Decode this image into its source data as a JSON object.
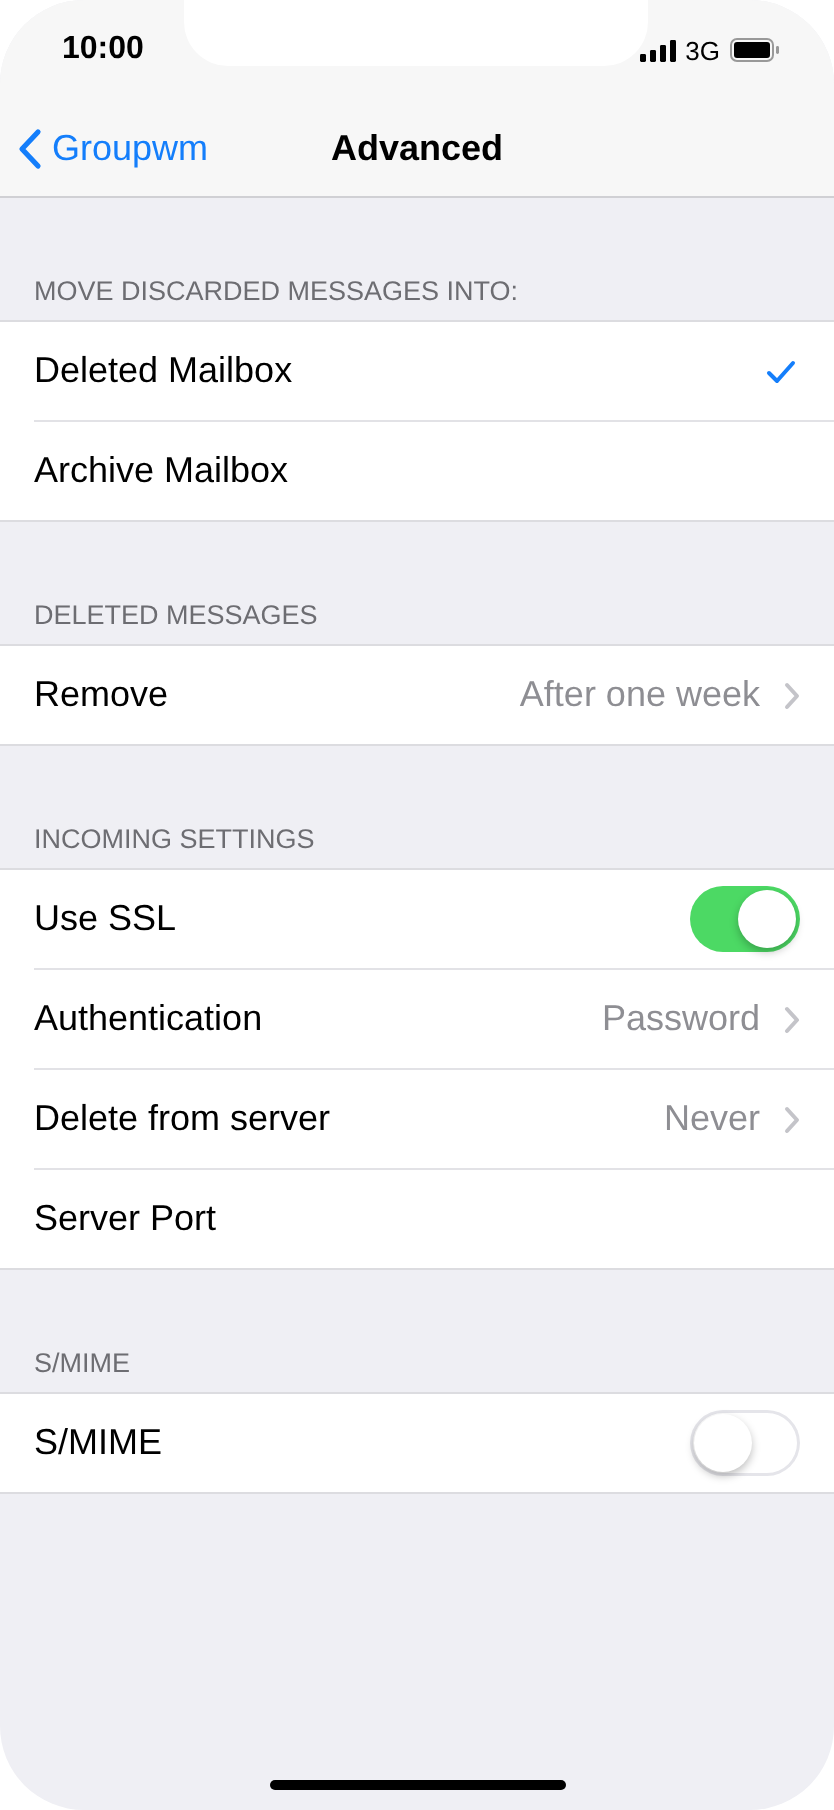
{
  "status_bar": {
    "time": "10:00",
    "network": "3G"
  },
  "nav": {
    "back": "Groupwm",
    "title": "Advanced"
  },
  "sections": [
    {
      "header": "MOVE DISCARDED MESSAGES INTO:",
      "rows": [
        {
          "kind": "choice",
          "label": "Deleted Mailbox",
          "selected": true
        },
        {
          "kind": "choice",
          "label": "Archive Mailbox",
          "selected": false
        }
      ]
    },
    {
      "header": "DELETED MESSAGES",
      "rows": [
        {
          "kind": "value",
          "label": "Remove",
          "value": "After one week"
        }
      ]
    },
    {
      "header": "INCOMING SETTINGS",
      "rows": [
        {
          "kind": "toggle",
          "label": "Use SSL",
          "on": true
        },
        {
          "kind": "value",
          "label": "Authentication",
          "value": "Password"
        },
        {
          "kind": "value",
          "label": "Delete from server",
          "value": "Never"
        },
        {
          "kind": "plain",
          "label": "Server Port"
        }
      ]
    },
    {
      "header": "S/MIME",
      "rows": [
        {
          "kind": "toggle",
          "label": "S/MIME",
          "on": false
        }
      ]
    }
  ]
}
